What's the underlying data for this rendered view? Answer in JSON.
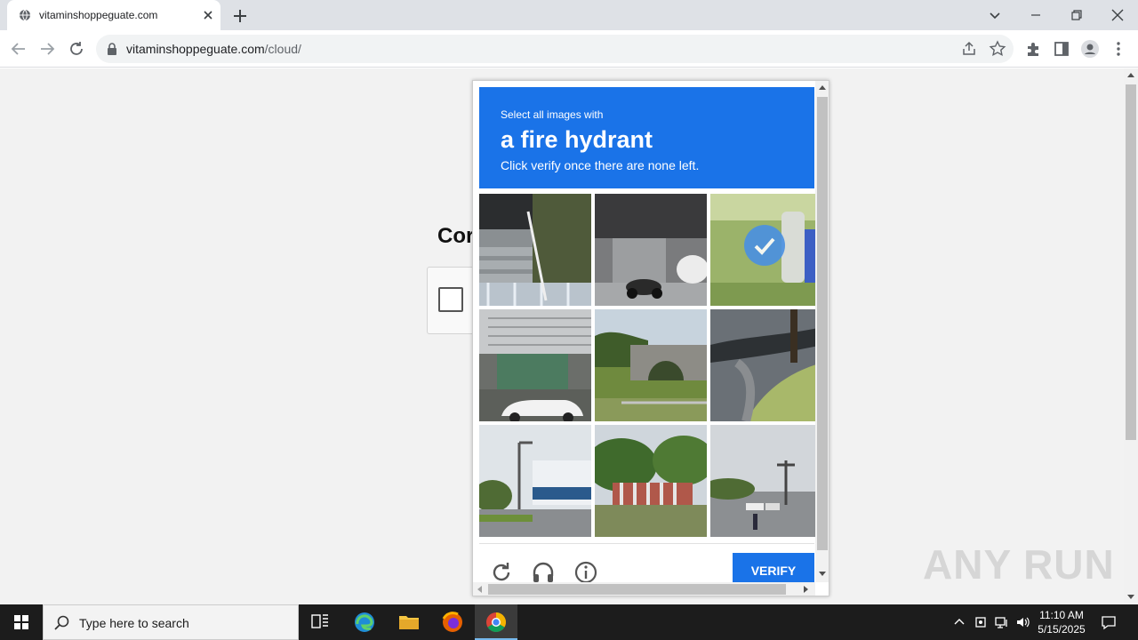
{
  "browser": {
    "tab_title": "vitaminshoppeguate.com",
    "url_host": "vitaminshoppeguate.com",
    "url_path": "/cloud/"
  },
  "page": {
    "heading_partial": "Cor"
  },
  "challenge": {
    "subtitle": "Select all images with",
    "target": "a fire hydrant",
    "instruction": "Click verify once there are none left.",
    "verify_label": "VERIFY",
    "header_color": "#1a73e8",
    "tiles": [
      {
        "content": "stairs with railing",
        "selected": false
      },
      {
        "content": "scooter by building",
        "selected": false
      },
      {
        "content": "fire hydrant on grass",
        "selected": true
      },
      {
        "content": "building with parked car",
        "selected": false
      },
      {
        "content": "stone bridge",
        "selected": false
      },
      {
        "content": "curb with grass",
        "selected": false
      },
      {
        "content": "street lamp and building",
        "selected": false
      },
      {
        "content": "fence with trees",
        "selected": false
      },
      {
        "content": "road intersection",
        "selected": false
      }
    ]
  },
  "watermark": "ANY RUN",
  "taskbar": {
    "search_placeholder": "Type here to search",
    "time": "11:10 AM",
    "date": "5/15/2025"
  }
}
